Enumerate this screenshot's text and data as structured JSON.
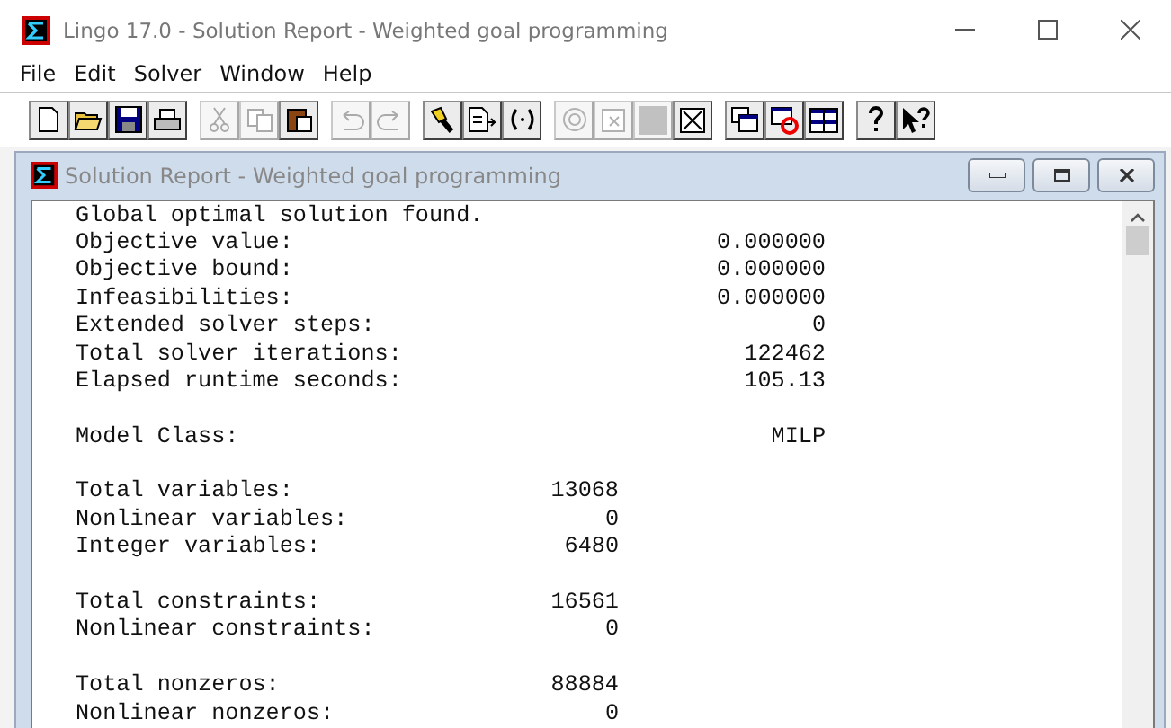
{
  "window": {
    "title": "Lingo 17.0 - Solution Report - Weighted goal programming"
  },
  "menu": [
    "File",
    "Edit",
    "Solver",
    "Window",
    "Help"
  ],
  "toolbar": [
    [
      {
        "kind": "new",
        "disabled": false
      },
      {
        "kind": "open",
        "disabled": false
      },
      {
        "kind": "save",
        "disabled": false
      },
      {
        "kind": "print",
        "disabled": false
      }
    ],
    [
      {
        "kind": "cut",
        "disabled": true
      },
      {
        "kind": "copy",
        "disabled": true
      },
      {
        "kind": "paste",
        "disabled": false
      }
    ],
    [
      {
        "kind": "undo",
        "disabled": true
      },
      {
        "kind": "redo",
        "disabled": true
      }
    ],
    [
      {
        "kind": "find",
        "disabled": false
      },
      {
        "kind": "goto",
        "disabled": false
      },
      {
        "kind": "match",
        "disabled": false
      }
    ],
    [
      {
        "kind": "solve",
        "disabled": true
      },
      {
        "kind": "solution",
        "disabled": true
      },
      {
        "kind": "stop",
        "disabled": true
      },
      {
        "kind": "closebox",
        "disabled": false
      }
    ],
    [
      {
        "kind": "cascade",
        "disabled": false
      },
      {
        "kind": "closeall",
        "disabled": false
      },
      {
        "kind": "tile",
        "disabled": false
      }
    ],
    [
      {
        "kind": "help",
        "disabled": false
      },
      {
        "kind": "contexthelp",
        "disabled": false
      }
    ]
  ],
  "report_window": {
    "title": "Solution Report - Weighted goal programming",
    "groups": [
      [
        {
          "label": "Global optimal solution found."
        },
        {
          "kind": "result",
          "label": "Objective value:",
          "value": "0.000000"
        },
        {
          "kind": "result",
          "label": "Objective bound:",
          "value": "0.000000"
        },
        {
          "kind": "result",
          "label": "Infeasibilities:",
          "value": "0.000000"
        },
        {
          "kind": "result",
          "label": "Extended solver steps:",
          "value": "0"
        },
        {
          "kind": "result",
          "label": "Total solver iterations:",
          "value": "122462"
        },
        {
          "kind": "result",
          "label": "Elapsed runtime seconds:",
          "value": "105.13"
        }
      ],
      [
        {
          "kind": "result",
          "label": "Model Class:",
          "value": "MILP"
        }
      ],
      [
        {
          "kind": "count",
          "label": "Total variables:",
          "value": "13068"
        },
        {
          "kind": "count",
          "label": "Nonlinear variables:",
          "value": "0"
        },
        {
          "kind": "count",
          "label": "Integer variables:",
          "value": "6480"
        }
      ],
      [
        {
          "kind": "count",
          "label": "Total constraints:",
          "value": "16561"
        },
        {
          "kind": "count",
          "label": "Nonlinear constraints:",
          "value": "0"
        }
      ],
      [
        {
          "kind": "count",
          "label": "Total nonzeros:",
          "value": "88884"
        },
        {
          "kind": "count",
          "label": "Nonlinear nonzeros:",
          "value": "0"
        }
      ]
    ]
  }
}
